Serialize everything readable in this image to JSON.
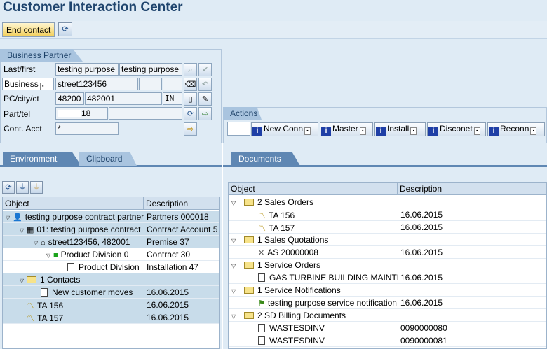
{
  "title": "Customer Interaction Center",
  "toolbar": {
    "end_contact": "End contact"
  },
  "business_partner": {
    "title": "Business Partner",
    "lastfirst_label": "Last/first",
    "last": "testing purpose",
    "first": "testing purpose",
    "business_label": "Business",
    "business_value": "street123456",
    "pc_label": "PC/city/ct",
    "pc": "48200",
    "city": "482001",
    "country": "IN",
    "parttel_label": "Part/tel",
    "parttel_value": "18",
    "contacct_label": "Cont. Acct",
    "contacct_value": "*"
  },
  "actions": {
    "title": "Actions",
    "buttons": [
      "New Conn",
      "Master",
      "Install",
      "Disconet",
      "Reconn"
    ]
  },
  "tabs": {
    "environment": "Environment",
    "clipboard": "Clipboard",
    "documents": "Documents"
  },
  "env_tree": {
    "col_object": "Object",
    "col_description": "Description",
    "rows": [
      {
        "object": "testing purpose contract partner",
        "description": "Partners 000018"
      },
      {
        "object": "01: testing purpose contract",
        "description": "Contract Account 5"
      },
      {
        "object": "street123456, 482001",
        "description": "Premise 37"
      },
      {
        "object": "Product Division 0",
        "description": "Contract 30"
      },
      {
        "object": "Product Division",
        "description": "Installation 47"
      },
      {
        "object": "1 Contacts",
        "description": ""
      },
      {
        "object": "New customer moves",
        "description": "16.06.2015"
      },
      {
        "object": "TA 156",
        "description": "16.06.2015"
      },
      {
        "object": "TA 157",
        "description": "16.06.2015"
      }
    ]
  },
  "doc_tree": {
    "col_object": "Object",
    "col_description": "Description",
    "rows": [
      {
        "object": "2 Sales Orders",
        "description": ""
      },
      {
        "object": "TA 156",
        "description": "16.06.2015"
      },
      {
        "object": "TA 157",
        "description": "16.06.2015"
      },
      {
        "object": "1 Sales Quotations",
        "description": ""
      },
      {
        "object": "AS 20000008",
        "description": "16.06.2015"
      },
      {
        "object": "1 Service Orders",
        "description": ""
      },
      {
        "object": "GAS TURBINE BUILDING MAINTENANCE",
        "description": "16.06.2015"
      },
      {
        "object": "1 Service Notifications",
        "description": ""
      },
      {
        "object": "testing purpose service notification",
        "description": "16.06.2015"
      },
      {
        "object": "2 SD Billing Documents",
        "description": ""
      },
      {
        "object": "WASTESDINV",
        "description": "0090000080"
      },
      {
        "object": "WASTESDINV",
        "description": "0090000081"
      }
    ]
  }
}
